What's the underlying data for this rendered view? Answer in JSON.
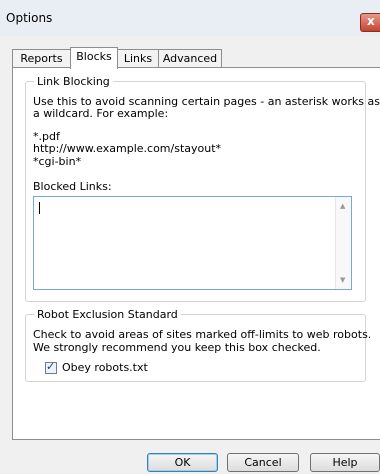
{
  "window": {
    "title": "Options",
    "close_glyph": "x"
  },
  "tabs": [
    {
      "label": "Reports",
      "active": false
    },
    {
      "label": "Blocks",
      "active": true
    },
    {
      "label": "Links",
      "active": false
    },
    {
      "label": "Advanced",
      "active": false
    }
  ],
  "link_blocking": {
    "legend": "Link Blocking",
    "description_line1": "Use this to avoid scanning certain pages - an asterisk works as",
    "description_line2": "a wildcard. For example:",
    "example1": "*.pdf",
    "example2": "http://www.example.com/stayout*",
    "example3": "*cgi-bin*",
    "blocked_links_label": "Blocked Links:",
    "blocked_links_value": ""
  },
  "robot_exclusion": {
    "legend": "Robot Exclusion Standard",
    "description_line1": "Check to avoid areas of sites marked off-limits to web robots.",
    "description_line2": "We strongly recommend you keep this box checked.",
    "checkbox_label": "Obey robots.txt",
    "checked": true
  },
  "buttons": {
    "ok": "OK",
    "cancel": "Cancel",
    "help": "Help"
  },
  "icons": {
    "close": "close-icon",
    "scroll_up": "scroll-up-icon",
    "scroll_down": "scroll-down-icon",
    "check": "checkmark-icon"
  }
}
